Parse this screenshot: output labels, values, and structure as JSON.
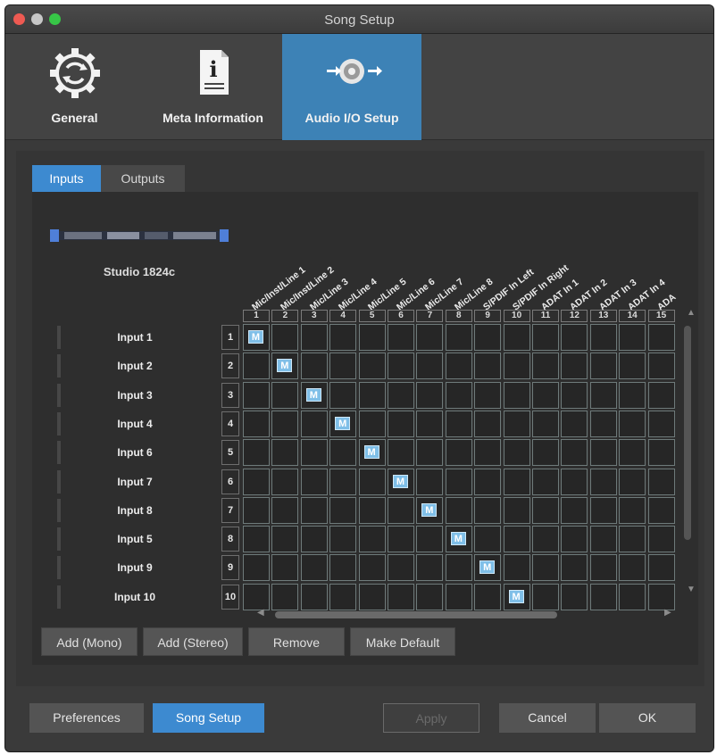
{
  "window": {
    "title": "Song Setup"
  },
  "toolbar": {
    "items": [
      {
        "label": "General",
        "icon": "gear-refresh-icon"
      },
      {
        "label": "Meta Information",
        "icon": "info-document-icon"
      },
      {
        "label": "Audio I/O Setup",
        "icon": "speaker-io-icon"
      }
    ],
    "selected": "Audio I/O Setup"
  },
  "tabs": [
    {
      "label": "Inputs",
      "active": true
    },
    {
      "label": "Outputs",
      "active": false
    }
  ],
  "device": {
    "name": "Studio 1824c"
  },
  "channels": [
    "Mic/Inst/Line 1",
    "Mic/Inst/Line 2",
    "Mic/Line 3",
    "Mic/Line 4",
    "Mic/Line 5",
    "Mic/Line 6",
    "Mic/Line 7",
    "Mic/Line 8",
    "S/PDIF In Left",
    "S/PDIF In Right",
    "ADAT In 1",
    "ADAT In 2",
    "ADAT In 3",
    "ADAT In 4",
    "ADA"
  ],
  "channel_numbers": [
    "1",
    "2",
    "3",
    "4",
    "5",
    "6",
    "7",
    "8",
    "9",
    "10",
    "11",
    "12",
    "13",
    "14",
    "15"
  ],
  "rows": [
    {
      "label": "Input 1",
      "num": "1",
      "marker_col": 1
    },
    {
      "label": "Input 2",
      "num": "2",
      "marker_col": 2
    },
    {
      "label": "Input 3",
      "num": "3",
      "marker_col": 3
    },
    {
      "label": "Input 4",
      "num": "4",
      "marker_col": 4
    },
    {
      "label": "Input 6",
      "num": "5",
      "marker_col": 5
    },
    {
      "label": "Input 7",
      "num": "6",
      "marker_col": 6
    },
    {
      "label": "Input 8",
      "num": "7",
      "marker_col": 7
    },
    {
      "label": "Input 5",
      "num": "8",
      "marker_col": 8
    },
    {
      "label": "Input 9",
      "num": "9",
      "marker_col": 9
    },
    {
      "label": "Input 10",
      "num": "10",
      "marker_col": 10
    }
  ],
  "marker_label": "M",
  "actions": {
    "add_mono": "Add (Mono)",
    "add_stereo": "Add (Stereo)",
    "remove": "Remove",
    "make_default": "Make Default"
  },
  "footer": {
    "preferences": "Preferences",
    "song_setup": "Song Setup",
    "apply": "Apply",
    "cancel": "Cancel",
    "ok": "OK"
  },
  "colors": {
    "accent": "#3d8ad0",
    "marker": "#7fbfe8"
  }
}
